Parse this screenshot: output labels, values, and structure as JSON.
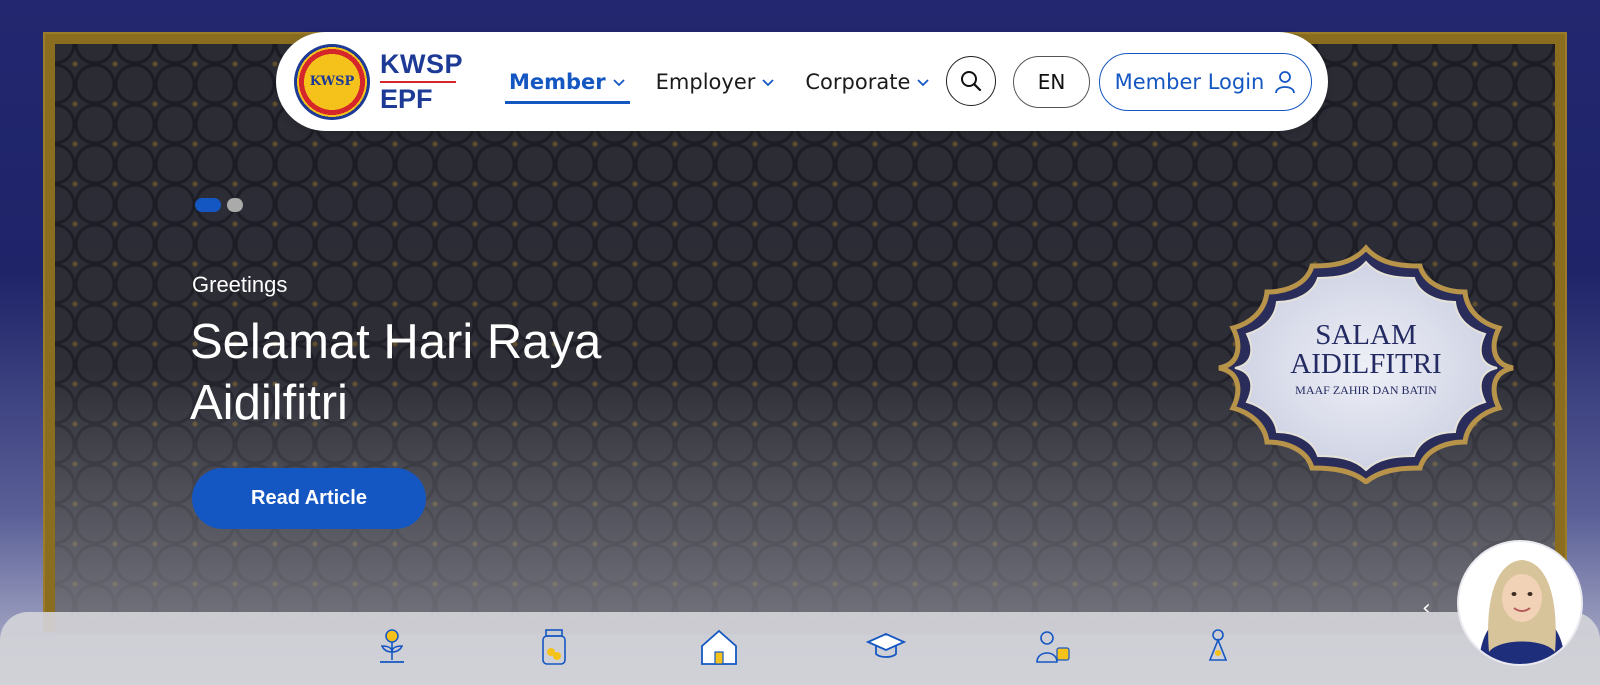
{
  "brand": {
    "name_top": "KWSP",
    "name_bottom": "EPF",
    "seal_text": "KWSP",
    "colors": {
      "primary": "#1557c2",
      "navy": "#1c3a96",
      "red": "#d4262b",
      "gold": "#f4c21a"
    }
  },
  "nav": {
    "menu": [
      {
        "label": "Member",
        "active": true
      },
      {
        "label": "Employer",
        "active": false
      },
      {
        "label": "Corporate",
        "active": false
      }
    ],
    "search_icon": "search-icon",
    "language": "EN",
    "login_label": "Member Login",
    "login_icon": "user-icon"
  },
  "hero": {
    "slides_total": 2,
    "active_slide": 1,
    "eyebrow": "Greetings",
    "headline": "Selamat Hari Raya Aidilfitri",
    "cta_label": "Read Article",
    "badge": {
      "line1": "SALAM",
      "line2": "AIDILFITRI",
      "line3": "MAAF ZAHIR DAN BATIN"
    },
    "prev_arrow": "‹"
  },
  "quick_links": [
    {
      "icon": "savings-plant-icon"
    },
    {
      "icon": "jar-coins-icon"
    },
    {
      "icon": "house-icon"
    },
    {
      "icon": "graduation-cap-icon"
    },
    {
      "icon": "healthcare-icon"
    },
    {
      "icon": "woman-icon"
    }
  ],
  "assistant": {
    "icon": "virtual-assistant-avatar"
  }
}
